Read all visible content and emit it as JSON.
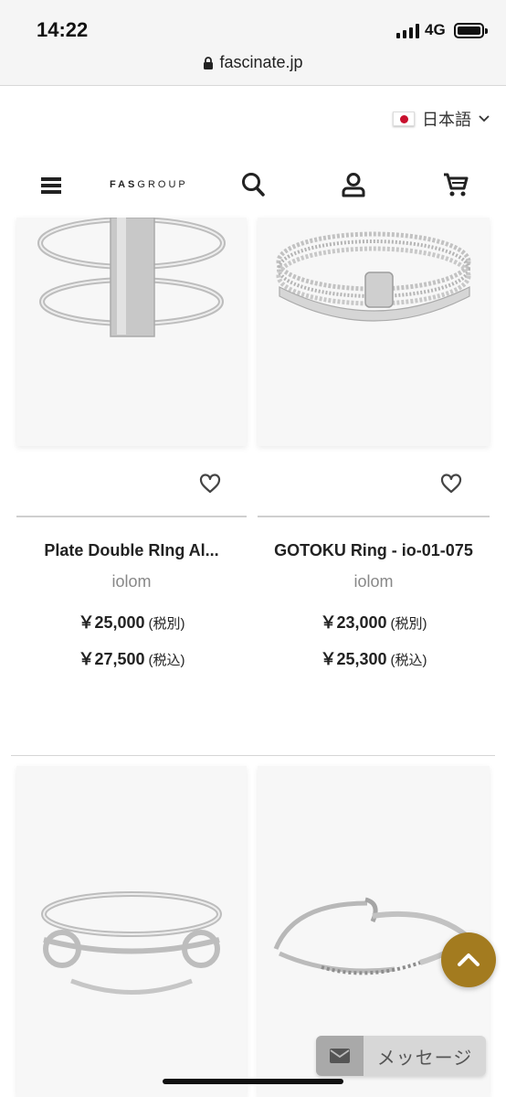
{
  "status": {
    "time": "14:22",
    "network": "4G"
  },
  "browser": {
    "url": "fascinate.jp"
  },
  "language": {
    "label": "日本語",
    "flag": "japan-flag-icon"
  },
  "header": {
    "logo_bold": "FAS",
    "logo_rest": "GROUP",
    "icons": [
      "menu-icon",
      "search-icon",
      "account-icon",
      "cart-icon"
    ]
  },
  "products": [
    {
      "name": "Plate Double RIng Al...",
      "brand": "iolom",
      "price_ex": "￥25,000",
      "tax_ex": "(税別)",
      "price_in": "￥27,500",
      "tax_in": "(税込)"
    },
    {
      "name": "GOTOKU Ring - io-01-075",
      "brand": "iolom",
      "price_ex": "￥23,000",
      "tax_ex": "(税別)",
      "price_in": "￥25,300",
      "tax_in": "(税込)"
    }
  ],
  "floating": {
    "message_label": "メッセージ"
  },
  "colors": {
    "accent": "#a37b1f",
    "message_bg": "#d7d7d7"
  }
}
